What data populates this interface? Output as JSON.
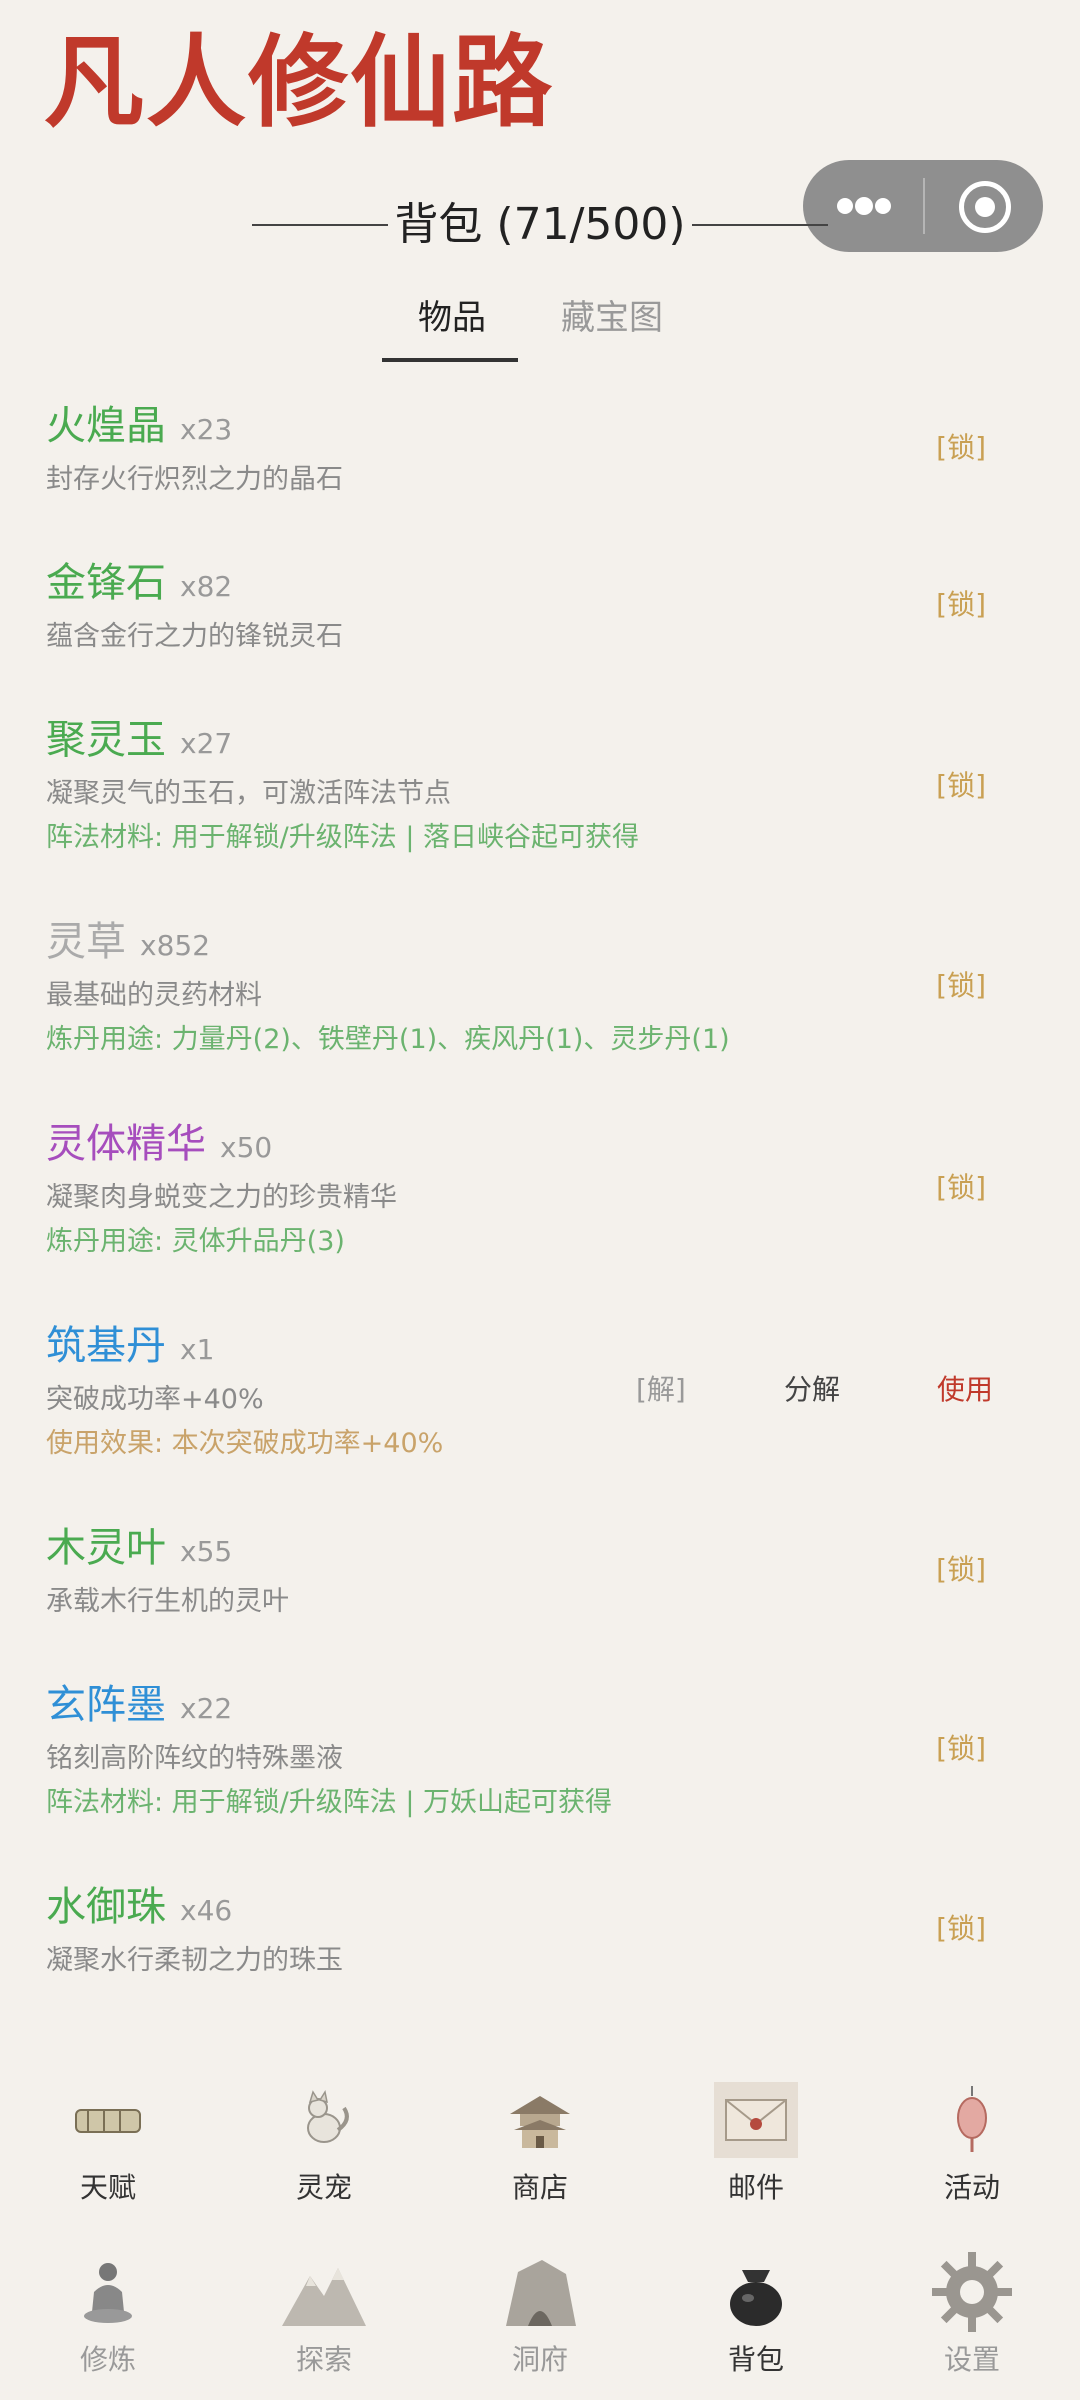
{
  "app": {
    "title": "凡人修仙路"
  },
  "header": {
    "bag_title": "背包 (71/500)"
  },
  "tabs": [
    {
      "label": "物品",
      "active": true
    },
    {
      "label": "藏宝图",
      "active": false
    }
  ],
  "items": [
    {
      "name": "火煌晶",
      "qty": "x23",
      "desc": "封存火行炽烈之力的晶石",
      "lock": "[锁]",
      "color": "#4aaa50"
    },
    {
      "name": "金锋石",
      "qty": "x82",
      "desc": "蕴含金行之力的锋锐灵石",
      "lock": "[锁]",
      "color": "#4aaa50"
    },
    {
      "name": "聚灵玉",
      "qty": "x27",
      "desc": "凝聚灵气的玉石，可激活阵法节点",
      "extra": "阵法材料: 用于解锁/升级阵法 | 落日峡谷起可获得",
      "lock": "[锁]",
      "color": "#4aaa50"
    },
    {
      "name": "灵草",
      "qty": "x852",
      "desc": "最基础的灵药材料",
      "extra": "炼丹用途: 力量丹(2)、铁壁丹(1)、疾风丹(1)、灵步丹(1)",
      "lock": "[锁]",
      "color": "#aaaaaa"
    },
    {
      "name": "灵体精华",
      "qty": "x50",
      "desc": "凝聚肉身蜕变之力的珍贵精华",
      "extra": "炼丹用途: 灵体升品丹(3)",
      "lock": "[锁]",
      "color": "#a64dbd"
    },
    {
      "name": "筑基丹",
      "qty": "x1",
      "desc": "突破成功率+40%",
      "extra": "使用效果: 本次突破成功率+40%",
      "unlock": "[解]",
      "decompose": "分解",
      "use": "使用",
      "color": "#2f8fd6"
    },
    {
      "name": "木灵叶",
      "qty": "x55",
      "desc": "承载木行生机的灵叶",
      "lock": "[锁]",
      "color": "#4aaa50"
    },
    {
      "name": "玄阵墨",
      "qty": "x22",
      "desc": "铭刻高阶阵纹的特殊墨液",
      "extra": "阵法材料: 用于解锁/升级阵法 | 万妖山起可获得",
      "lock": "[锁]",
      "color": "#2f8fd6"
    },
    {
      "name": "水御珠",
      "qty": "x46",
      "desc": "凝聚水行柔韧之力的珠玉",
      "lock": "[锁]",
      "color": "#4aaa50"
    }
  ],
  "nav_top": [
    {
      "label": "天赋",
      "icon": "scroll-icon"
    },
    {
      "label": "灵宠",
      "icon": "fox-icon"
    },
    {
      "label": "商店",
      "icon": "pavilion-icon"
    },
    {
      "label": "邮件",
      "icon": "envelope-icon"
    },
    {
      "label": "活动",
      "icon": "lantern-icon"
    }
  ],
  "nav_bottom": [
    {
      "label": "修炼",
      "icon": "meditation-icon"
    },
    {
      "label": "探索",
      "icon": "mountain-icon"
    },
    {
      "label": "洞府",
      "icon": "cave-icon"
    },
    {
      "label": "背包",
      "icon": "pouch-icon",
      "active": true
    },
    {
      "label": "设置",
      "icon": "gear-icon"
    }
  ]
}
